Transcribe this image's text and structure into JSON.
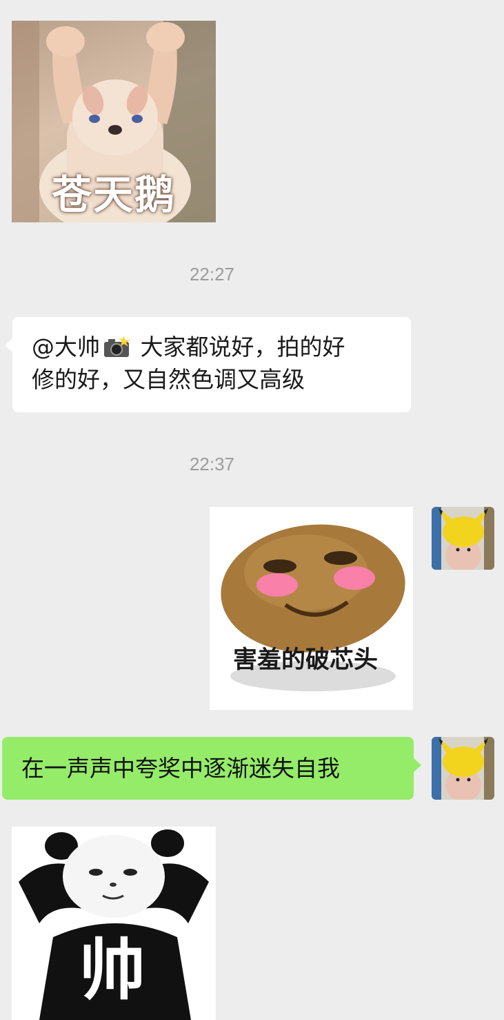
{
  "theme": {
    "chat_bg": "#ededed",
    "incoming_bubble": "#ffffff",
    "outgoing_bubble": "#95ec69",
    "timestamp_color": "#9b9b9b"
  },
  "messages": [
    {
      "type": "sticker",
      "side": "left",
      "icon": "bunny-mascot-sticker",
      "caption": "苍天鹅"
    },
    {
      "type": "timestamp",
      "time": "22:27"
    },
    {
      "type": "text",
      "side": "left",
      "mention": "@大帅",
      "icon": "camera-flash-emoji",
      "line1": "大家都说好，拍的好",
      "line2": "修的好，又自然色调又高级"
    },
    {
      "type": "timestamp",
      "time": "22:37"
    },
    {
      "type": "sticker",
      "side": "right",
      "icon": "blushing-potato-sticker",
      "caption": "害羞的破芯头",
      "avatar": "pikachu-hat-hamster-avatar"
    },
    {
      "type": "text",
      "side": "right",
      "text": "在一声声中夸奖中逐渐迷失自我",
      "avatar": "pikachu-hat-hamster-avatar"
    },
    {
      "type": "sticker",
      "side": "left",
      "icon": "panda-meme-sticker",
      "caption": "帅"
    }
  ]
}
